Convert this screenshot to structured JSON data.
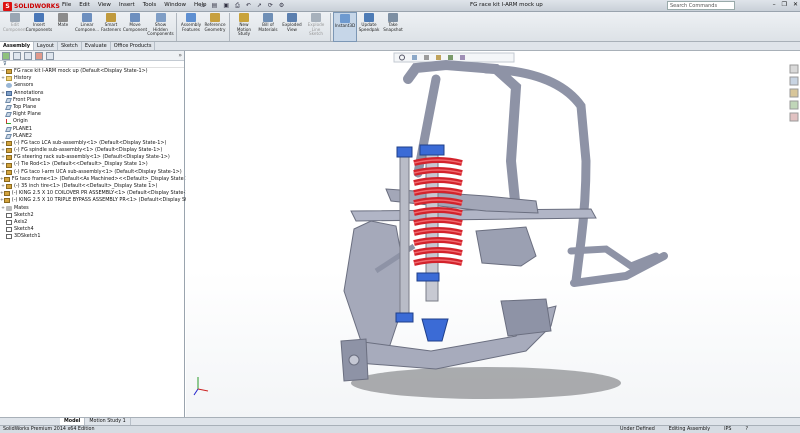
{
  "app": {
    "brand": "SOLIDWORKS",
    "document_title": "FG race kit I-ARM mock up",
    "menu": [
      "File",
      "Edit",
      "View",
      "Insert",
      "Tools",
      "Window",
      "Help"
    ],
    "search_placeholder": "Search Commands"
  },
  "ribbon": {
    "buttons": [
      {
        "label": "Edit Component",
        "disabled": true,
        "color": "#9aa6b3"
      },
      {
        "label": "Insert Components",
        "disabled": false,
        "color": "#4a78b8"
      },
      {
        "label": "Mate",
        "disabled": false,
        "color": "#8c8c8c"
      },
      {
        "label": "Linear Compone...",
        "disabled": false,
        "color": "#6d8fbf"
      },
      {
        "label": "Smart Fasteners",
        "disabled": false,
        "color": "#c09a3d"
      },
      {
        "label": "Move Component",
        "disabled": false,
        "color": "#6d8fbf"
      },
      {
        "label": "Show Hidden Components",
        "disabled": false,
        "color": "#7f9ec6"
      },
      {
        "label": "Assembly Features",
        "disabled": false,
        "color": "#5e8fd1"
      },
      {
        "label": "Reference Geometry",
        "disabled": false,
        "color": "#c7a040"
      },
      {
        "label": "New Motion Study",
        "disabled": false,
        "color": "#c9a33b"
      },
      {
        "label": "Bill of Materials",
        "disabled": false,
        "color": "#6f8fb6"
      },
      {
        "label": "Exploded View",
        "disabled": false,
        "color": "#5b7faf"
      },
      {
        "label": "Explode Line Sketch",
        "disabled": true,
        "color": "#a7b1bc"
      },
      {
        "label": "Instant3D",
        "disabled": false,
        "active": true,
        "color": "#6e9ad0"
      },
      {
        "label": "Update Speedpak",
        "disabled": false,
        "color": "#4e7cb6"
      },
      {
        "label": "Take Snapshot",
        "disabled": false,
        "color": "#7d8fa3"
      }
    ]
  },
  "tabs": [
    "Assembly",
    "Layout",
    "Sketch",
    "Evaluate",
    "Office Products"
  ],
  "active_tab": "Assembly",
  "feature_manager": {
    "root": "FG race kit I-ARM mock up  (Default<Display State-1>)",
    "items": [
      {
        "label": "History",
        "icon": "folder",
        "expand": "+"
      },
      {
        "label": "Sensors",
        "icon": "sensor",
        "expand": ""
      },
      {
        "label": "Annotations",
        "icon": "ann",
        "expand": "+"
      },
      {
        "label": "Front Plane",
        "icon": "plane",
        "expand": ""
      },
      {
        "label": "Top Plane",
        "icon": "plane",
        "expand": ""
      },
      {
        "label": "Right Plane",
        "icon": "plane",
        "expand": ""
      },
      {
        "label": "Origin",
        "icon": "origin",
        "expand": ""
      },
      {
        "label": "PLANE1",
        "icon": "plane",
        "expand": ""
      },
      {
        "label": "PLANE2",
        "icon": "plane",
        "expand": ""
      },
      {
        "label": "(-) FG taco LCA sub-assembly<1> (Default<Display State-1>)",
        "icon": "asm",
        "expand": "+"
      },
      {
        "label": "(-) FG spindle sub-assembly<1> (Default<Display State-1>)",
        "icon": "asm",
        "expand": "+"
      },
      {
        "label": "FG steering rack sub-assembly<1> (Default<Display State-1>)",
        "icon": "asm",
        "expand": "+"
      },
      {
        "label": "(-) Tie Rod<1> (Default<<Default>_Display State 1>)",
        "icon": "asm",
        "expand": "+"
      },
      {
        "label": "(-) FG taco I-arm UCA sub-assembly<1> (Default<Display State-1>)",
        "icon": "asm",
        "expand": "+"
      },
      {
        "label": "FG taco frame<1> (Default<As Machined><<Default>_Display State 1>)",
        "icon": "asm",
        "expand": "+"
      },
      {
        "label": "(-) 35 inch tire<1> (Default<<Default>_Display State 1>)",
        "icon": "asm",
        "expand": "+"
      },
      {
        "label": "(-) KING 2.5 X 10 COILOVER PR ASSEMBLY<1> (Default<Display State-1>)",
        "icon": "asm",
        "expand": "+"
      },
      {
        "label": "(-) KING 2.5 X 10 TRIPLE BYPASS ASSEMBLY PR<1> (Default<Display State-1>)",
        "icon": "asm",
        "expand": "+"
      },
      {
        "label": "Mates",
        "icon": "mate",
        "expand": "+"
      },
      {
        "label": "Sketch2",
        "icon": "sketch",
        "expand": ""
      },
      {
        "label": "Axis2",
        "icon": "sketch",
        "expand": ""
      },
      {
        "label": "Sketch4",
        "icon": "sketch",
        "expand": ""
      },
      {
        "label": "3DSketch1",
        "icon": "sketch",
        "expand": ""
      }
    ]
  },
  "bottom_tabs": [
    "Model",
    "Motion Study 1"
  ],
  "status": {
    "left": "SolidWorks Premium 2014 x64 Edition",
    "state": "Under Defined",
    "mode": "Editing Assembly",
    "units": "IPS"
  },
  "colors": {
    "spring": "#d3232c",
    "frame": "#9ea3b5",
    "anodized": "#3b6bd6"
  }
}
